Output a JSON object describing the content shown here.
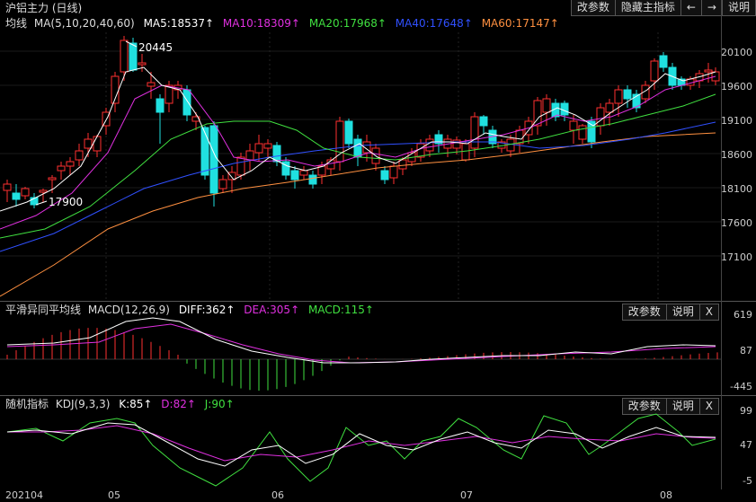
{
  "title": "沪铝主力 (日线)",
  "top_buttons": [
    "改参数",
    "隐藏主指标",
    "←",
    "→",
    "说明"
  ],
  "ma": {
    "name": "均线",
    "params": "MA(5,10,20,40,60)",
    "items": [
      {
        "label": "MA5:18537↑",
        "color": "#ffffff"
      },
      {
        "label": "MA10:18309↑",
        "color": "#e030e0"
      },
      {
        "label": "MA20:17968↑",
        "color": "#40e040"
      },
      {
        "label": "MA40:17648↑",
        "color": "#3050ff"
      },
      {
        "label": "MA60:17147↑",
        "color": "#ff9040"
      }
    ],
    "high_label": "20445",
    "low_label": "17900",
    "price_axis": [
      "20100",
      "19600",
      "19100",
      "18600",
      "18100",
      "17600",
      "17100"
    ]
  },
  "macd": {
    "name": "平滑异同平均线",
    "params": "MACD(12,26,9)",
    "items": [
      {
        "label": "DIFF:362↑",
        "color": "#ffffff"
      },
      {
        "label": "DEA:305↑",
        "color": "#e030e0"
      },
      {
        "label": "MACD:115↑",
        "color": "#40e040"
      }
    ],
    "buttons": [
      "改参数",
      "说明",
      "X"
    ],
    "axis": [
      "619",
      "87",
      "-445"
    ]
  },
  "kdj": {
    "name": "随机指标",
    "params": "KDJ(9,3,3)",
    "items": [
      {
        "label": "K:85↑",
        "color": "#ffffff"
      },
      {
        "label": "D:82↑",
        "color": "#e030e0"
      },
      {
        "label": "J:90↑",
        "color": "#40e040"
      }
    ],
    "buttons": [
      "改参数",
      "说明",
      "X"
    ],
    "axis": [
      "99",
      "47",
      "-5"
    ]
  },
  "x_axis": [
    "202104",
    "05",
    "06",
    "07",
    "08"
  ],
  "colors": {
    "up": "#ff3030",
    "down": "#20e0e0",
    "grid": "#444444"
  }
}
